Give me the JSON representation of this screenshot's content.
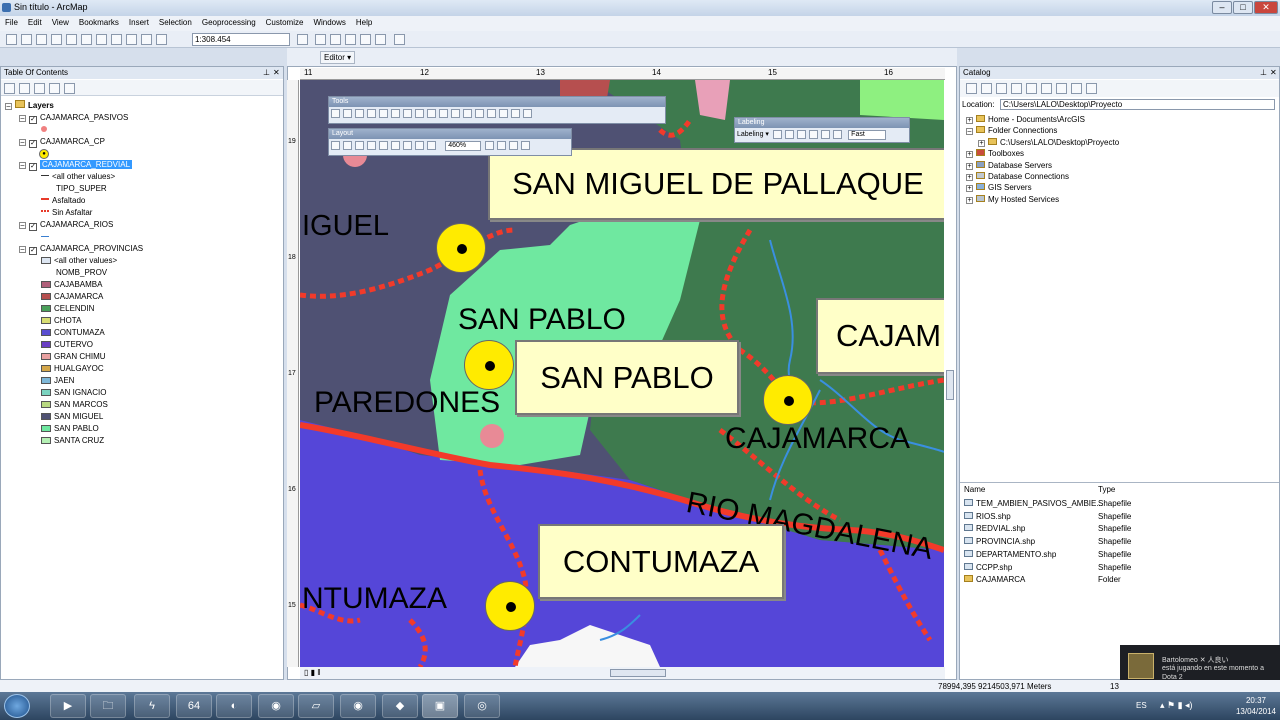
{
  "window": {
    "title": "Sin título - ArcMap",
    "min": "–",
    "max": "□",
    "close": "✕"
  },
  "menu": [
    "File",
    "Edit",
    "View",
    "Bookmarks",
    "Insert",
    "Selection",
    "Geoprocessing",
    "Customize",
    "Windows",
    "Help"
  ],
  "toolbar": {
    "scale": "1:308.454",
    "editor": "Editor ▾"
  },
  "toc": {
    "title": "Table Of Contents",
    "root": "Layers",
    "layers": [
      {
        "name": "CAJAMARCA_PASIVOS"
      },
      {
        "name": "CAJAMARCA_CP"
      },
      {
        "name": "CAJAMARCA_REDVIAL",
        "selected": true,
        "legend_heading": "<all other values>",
        "field": "TIPO_SUPER",
        "classes": [
          {
            "label": "Asfaltado",
            "color": "#e83a2a"
          },
          {
            "label": "Sin Asfaltar",
            "color": "#e83a2a"
          }
        ]
      },
      {
        "name": "CAJAMARCA_RIOS"
      },
      {
        "name": "CAJAMARCA_PROVINCIAS",
        "legend_heading": "<all other values>",
        "field": "NOMB_PROV",
        "classes": [
          {
            "label": "CAJABAMBA",
            "color": "#b0607a"
          },
          {
            "label": "CAJAMARCA",
            "color": "#b64f4f"
          },
          {
            "label": "CELENDIN",
            "color": "#4aa05a"
          },
          {
            "label": "CHOTA",
            "color": "#d8de72"
          },
          {
            "label": "CONTUMAZA",
            "color": "#5a4ed2"
          },
          {
            "label": "CUTERVO",
            "color": "#6a3fc4"
          },
          {
            "label": "GRAN CHIMU",
            "color": "#e8a0a0"
          },
          {
            "label": "HUALGAYOC",
            "color": "#d4a74a"
          },
          {
            "label": "JAEN",
            "color": "#7fb8d8"
          },
          {
            "label": "SAN IGNACIO",
            "color": "#7bd4c0"
          },
          {
            "label": "SAN MARCOS",
            "color": "#b8d880"
          },
          {
            "label": "SAN MIGUEL",
            "color": "#4f5173"
          },
          {
            "label": "SAN PABLO",
            "color": "#6ee8a0"
          },
          {
            "label": "SANTA CRUZ",
            "color": "#b4f0b4"
          }
        ]
      }
    ]
  },
  "map": {
    "ruler_top": [
      "11",
      "12",
      "13",
      "14",
      "15",
      "16"
    ],
    "ruler_left": [
      "19",
      "18",
      "17",
      "16",
      "15"
    ],
    "labels": {
      "san_miguel_de_pallaque": "SAN MIGUEL DE PALLAQUE",
      "iguel": "IGUEL",
      "san_pablo_prov": "SAN PABLO",
      "san_pablo_box": "SAN PABLO",
      "cajam": "CAJAM",
      "paredones": "PAREDONES",
      "cajamarca": "CAJAMARCA",
      "rio_magdalena": "RIO MAGDALENA",
      "contumaza_box": "CONTUMAZA",
      "ntumaza": "NTUMAZA"
    },
    "status": "▯ ▮ ‖"
  },
  "tools_bar": {
    "title": "Tools"
  },
  "layout_bar": {
    "title": "Layout",
    "zoom": "460%"
  },
  "labeling_bar": {
    "title": "Labeling",
    "menu": "Labeling ▾",
    "mode": "Fast"
  },
  "catalog": {
    "title": "Catalog",
    "location_label": "Location:",
    "location": "C:\\Users\\LALO\\Desktop\\Proyecto",
    "tree": [
      "Home - Documents\\ArcGIS",
      "Folder Connections",
      "C:\\Users\\LALO\\Desktop\\Proyecto",
      "Toolboxes",
      "Database Servers",
      "Database Connections",
      "GIS Servers",
      "My Hosted Services"
    ],
    "list_headers": {
      "name": "Name",
      "type": "Type"
    },
    "items": [
      {
        "name": "TEM_AMBIEN_PASIVOS_AMBIE...",
        "type": "Shapefile"
      },
      {
        "name": "RIOS.shp",
        "type": "Shapefile"
      },
      {
        "name": "REDVIAL.shp",
        "type": "Shapefile"
      },
      {
        "name": "PROVINCIA.shp",
        "type": "Shapefile"
      },
      {
        "name": "DEPARTAMENTO.shp",
        "type": "Shapefile"
      },
      {
        "name": "CCPP.shp",
        "type": "Shapefile"
      },
      {
        "name": "CAJAMARCA",
        "type": "Folder"
      }
    ]
  },
  "notification": {
    "user": "Bartolomeo ✕ 人良い",
    "line1": "está jugando en este momento a",
    "line2": "Dota 2"
  },
  "statusbar": {
    "coords": "78994,395  9214503,971 Meters",
    "right": "13"
  },
  "taskbar": {
    "lang": "ES",
    "time": "20:37",
    "date": "13/04/2014",
    "apps": [
      "▶",
      "🗀",
      "ϟ",
      "64",
      "◐",
      "◉",
      "▱",
      "◉",
      "◆",
      "▣",
      "◎"
    ]
  }
}
